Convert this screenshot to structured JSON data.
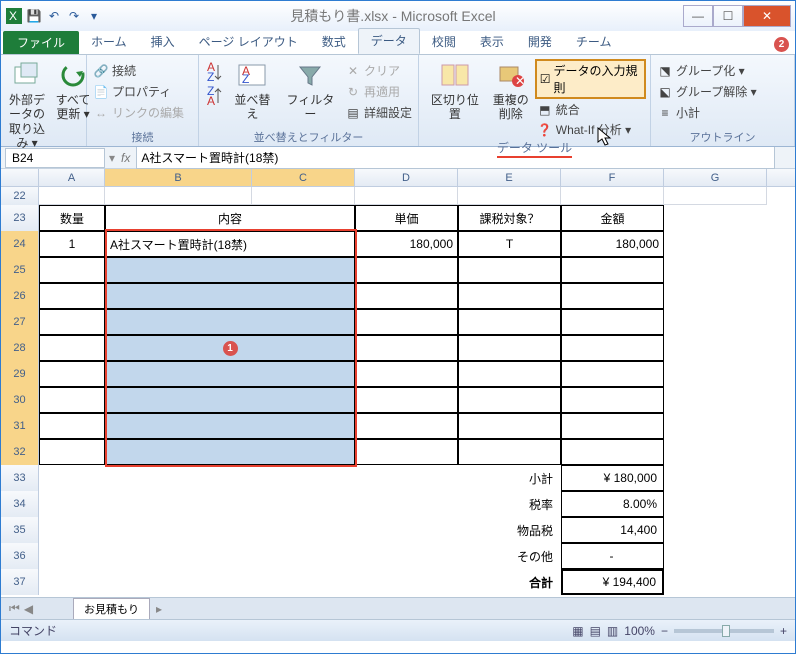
{
  "title": "見積もり書.xlsx - Microsoft Excel",
  "tabs": {
    "file": "ファイル",
    "home": "ホーム",
    "insert": "挿入",
    "layout": "ページ レイアウト",
    "formula": "数式",
    "data": "データ",
    "review": "校閲",
    "view": "表示",
    "dev": "開発",
    "team": "チーム"
  },
  "ribbon": {
    "ext_data": "外部データの\n取り込み ▾",
    "refresh": "すべて\n更新 ▾",
    "conn": "接続",
    "prop": "プロパティ",
    "editlink": "リンクの編集",
    "grp_conn": "接続",
    "sort": "並べ替え",
    "filter": "フィルター",
    "clear": "クリア",
    "reapply": "再適用",
    "adv": "詳細設定",
    "grp_sort": "並べ替えとフィルター",
    "t2c": "区切り位置",
    "dedup": "重複の\n削除",
    "dvalid": "データの入力規則",
    "consol": "統合",
    "whatif": "What-If 分析 ▾",
    "grp_dt": "データ ツール",
    "group": "グループ化 ▾",
    "ungroup": "グループ解除 ▾",
    "subtotal": "小計",
    "grp_ol": "アウトライン"
  },
  "namebox": "B24",
  "formula": "A社スマート置時計(18禁)",
  "cols": {
    "A": "A",
    "B": "B",
    "C": "C",
    "D": "D",
    "E": "E",
    "F": "F",
    "G": "G"
  },
  "rows": [
    "22",
    "23",
    "24",
    "25",
    "26",
    "27",
    "28",
    "29",
    "30",
    "31",
    "32",
    "33",
    "34",
    "35",
    "36",
    "37"
  ],
  "hdr": {
    "qty": "数量",
    "content": "内容",
    "unit": "単価",
    "tax": "課税対象？",
    "amount": "金額"
  },
  "r24": {
    "qty": "1",
    "content": "A社スマート置時計(18禁)",
    "unit": "180,000",
    "tax": "T",
    "amount": "180,000"
  },
  "sum": {
    "subtotal_l": "小計",
    "subtotal_v": "¥    180,000",
    "rate_l": "税率",
    "rate_v": "8.00%",
    "tax_l": "物品税",
    "tax_v": "14,400",
    "other_l": "その他",
    "other_v": "-",
    "total_l": "合計",
    "total_v": "¥    194,400"
  },
  "sheet_tab": "お見積もり",
  "status": "コマンド",
  "zoom": "100%"
}
